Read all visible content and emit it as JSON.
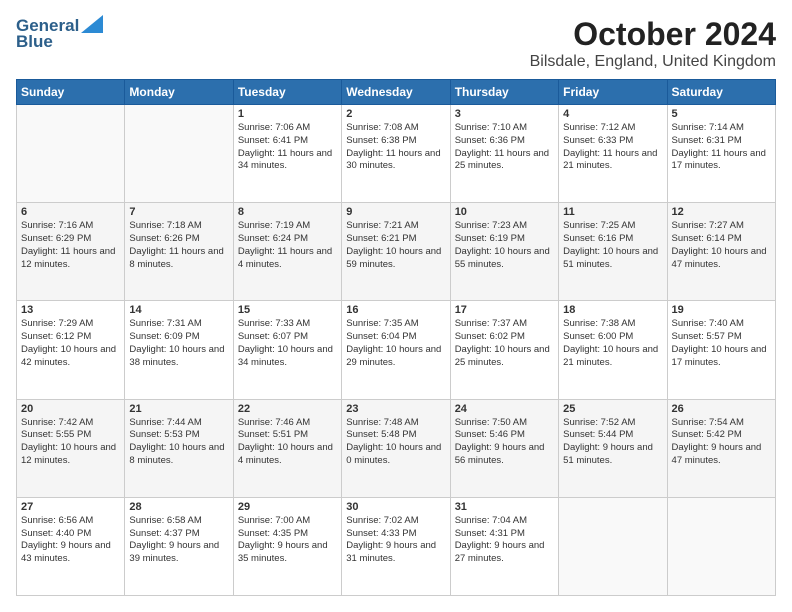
{
  "header": {
    "logo_line1": "General",
    "logo_line2": "Blue",
    "month": "October 2024",
    "location": "Bilsdale, England, United Kingdom"
  },
  "days_of_week": [
    "Sunday",
    "Monday",
    "Tuesday",
    "Wednesday",
    "Thursday",
    "Friday",
    "Saturday"
  ],
  "weeks": [
    [
      {
        "day": "",
        "info": ""
      },
      {
        "day": "",
        "info": ""
      },
      {
        "day": "1",
        "info": "Sunrise: 7:06 AM\nSunset: 6:41 PM\nDaylight: 11 hours and 34 minutes."
      },
      {
        "day": "2",
        "info": "Sunrise: 7:08 AM\nSunset: 6:38 PM\nDaylight: 11 hours and 30 minutes."
      },
      {
        "day": "3",
        "info": "Sunrise: 7:10 AM\nSunset: 6:36 PM\nDaylight: 11 hours and 25 minutes."
      },
      {
        "day": "4",
        "info": "Sunrise: 7:12 AM\nSunset: 6:33 PM\nDaylight: 11 hours and 21 minutes."
      },
      {
        "day": "5",
        "info": "Sunrise: 7:14 AM\nSunset: 6:31 PM\nDaylight: 11 hours and 17 minutes."
      }
    ],
    [
      {
        "day": "6",
        "info": "Sunrise: 7:16 AM\nSunset: 6:29 PM\nDaylight: 11 hours and 12 minutes."
      },
      {
        "day": "7",
        "info": "Sunrise: 7:18 AM\nSunset: 6:26 PM\nDaylight: 11 hours and 8 minutes."
      },
      {
        "day": "8",
        "info": "Sunrise: 7:19 AM\nSunset: 6:24 PM\nDaylight: 11 hours and 4 minutes."
      },
      {
        "day": "9",
        "info": "Sunrise: 7:21 AM\nSunset: 6:21 PM\nDaylight: 10 hours and 59 minutes."
      },
      {
        "day": "10",
        "info": "Sunrise: 7:23 AM\nSunset: 6:19 PM\nDaylight: 10 hours and 55 minutes."
      },
      {
        "day": "11",
        "info": "Sunrise: 7:25 AM\nSunset: 6:16 PM\nDaylight: 10 hours and 51 minutes."
      },
      {
        "day": "12",
        "info": "Sunrise: 7:27 AM\nSunset: 6:14 PM\nDaylight: 10 hours and 47 minutes."
      }
    ],
    [
      {
        "day": "13",
        "info": "Sunrise: 7:29 AM\nSunset: 6:12 PM\nDaylight: 10 hours and 42 minutes."
      },
      {
        "day": "14",
        "info": "Sunrise: 7:31 AM\nSunset: 6:09 PM\nDaylight: 10 hours and 38 minutes."
      },
      {
        "day": "15",
        "info": "Sunrise: 7:33 AM\nSunset: 6:07 PM\nDaylight: 10 hours and 34 minutes."
      },
      {
        "day": "16",
        "info": "Sunrise: 7:35 AM\nSunset: 6:04 PM\nDaylight: 10 hours and 29 minutes."
      },
      {
        "day": "17",
        "info": "Sunrise: 7:37 AM\nSunset: 6:02 PM\nDaylight: 10 hours and 25 minutes."
      },
      {
        "day": "18",
        "info": "Sunrise: 7:38 AM\nSunset: 6:00 PM\nDaylight: 10 hours and 21 minutes."
      },
      {
        "day": "19",
        "info": "Sunrise: 7:40 AM\nSunset: 5:57 PM\nDaylight: 10 hours and 17 minutes."
      }
    ],
    [
      {
        "day": "20",
        "info": "Sunrise: 7:42 AM\nSunset: 5:55 PM\nDaylight: 10 hours and 12 minutes."
      },
      {
        "day": "21",
        "info": "Sunrise: 7:44 AM\nSunset: 5:53 PM\nDaylight: 10 hours and 8 minutes."
      },
      {
        "day": "22",
        "info": "Sunrise: 7:46 AM\nSunset: 5:51 PM\nDaylight: 10 hours and 4 minutes."
      },
      {
        "day": "23",
        "info": "Sunrise: 7:48 AM\nSunset: 5:48 PM\nDaylight: 10 hours and 0 minutes."
      },
      {
        "day": "24",
        "info": "Sunrise: 7:50 AM\nSunset: 5:46 PM\nDaylight: 9 hours and 56 minutes."
      },
      {
        "day": "25",
        "info": "Sunrise: 7:52 AM\nSunset: 5:44 PM\nDaylight: 9 hours and 51 minutes."
      },
      {
        "day": "26",
        "info": "Sunrise: 7:54 AM\nSunset: 5:42 PM\nDaylight: 9 hours and 47 minutes."
      }
    ],
    [
      {
        "day": "27",
        "info": "Sunrise: 6:56 AM\nSunset: 4:40 PM\nDaylight: 9 hours and 43 minutes."
      },
      {
        "day": "28",
        "info": "Sunrise: 6:58 AM\nSunset: 4:37 PM\nDaylight: 9 hours and 39 minutes."
      },
      {
        "day": "29",
        "info": "Sunrise: 7:00 AM\nSunset: 4:35 PM\nDaylight: 9 hours and 35 minutes."
      },
      {
        "day": "30",
        "info": "Sunrise: 7:02 AM\nSunset: 4:33 PM\nDaylight: 9 hours and 31 minutes."
      },
      {
        "day": "31",
        "info": "Sunrise: 7:04 AM\nSunset: 4:31 PM\nDaylight: 9 hours and 27 minutes."
      },
      {
        "day": "",
        "info": ""
      },
      {
        "day": "",
        "info": ""
      }
    ]
  ]
}
